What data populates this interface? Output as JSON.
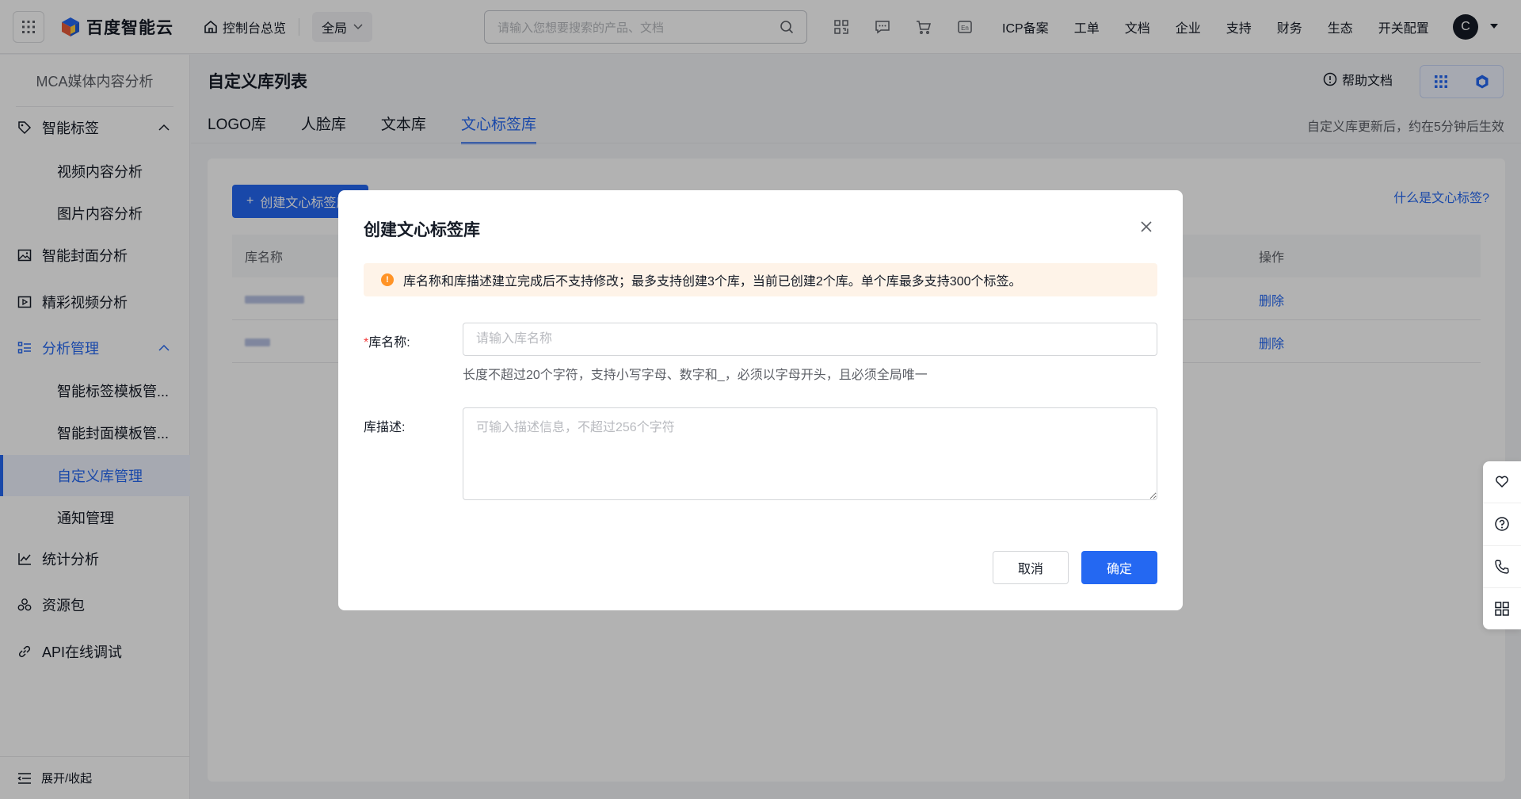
{
  "topbar": {
    "brand": "百度智能云",
    "console": "控制台总览",
    "scope": "全局",
    "search_placeholder": "请输入您想要搜索的产品、文档",
    "links": [
      "ICP备案",
      "工单",
      "文档",
      "企业",
      "支持",
      "财务",
      "生态",
      "开关配置"
    ],
    "avatar": "C"
  },
  "sidebar": {
    "title": "MCA媒体内容分析",
    "items": [
      {
        "label": "智能标签",
        "icon": "tag-icon"
      },
      {
        "label": "视频内容分析"
      },
      {
        "label": "图片内容分析"
      },
      {
        "label": "智能封面分析",
        "icon": "image-icon"
      },
      {
        "label": "精彩视频分析",
        "icon": "video-icon"
      },
      {
        "label": "分析管理",
        "icon": "list-icon"
      },
      {
        "label": "智能标签模板管..."
      },
      {
        "label": "智能封面模板管..."
      },
      {
        "label": "自定义库管理"
      },
      {
        "label": "通知管理"
      },
      {
        "label": "统计分析",
        "icon": "chart-icon"
      },
      {
        "label": "资源包",
        "icon": "package-icon"
      },
      {
        "label": "API在线调试",
        "icon": "link-icon"
      }
    ],
    "footer": "展开/收起"
  },
  "main": {
    "title": "自定义库列表",
    "help": "帮助文档",
    "tabs": [
      "LOGO库",
      "人脸库",
      "文本库",
      "文心标签库"
    ],
    "tab_note": "自定义库更新后，约在5分钟后生效",
    "create_button": "创建文心标签库",
    "what_link": "什么是文心标签?",
    "table": {
      "col_name": "库名称",
      "col_action": "操作",
      "rows": [
        {
          "action": "删除"
        },
        {
          "action": "删除"
        }
      ]
    }
  },
  "modal": {
    "title": "创建文心标签库",
    "alert": "库名称和库描述建立完成后不支持修改；最多支持创建3个库，当前已创建2个库。单个库最多支持300个标签。",
    "name_required": "*",
    "name_label": "库名称:",
    "name_placeholder": "请输入库名称",
    "name_value": "",
    "name_hint": "长度不超过20个字符，支持小写字母、数字和_，必须以字母开头，且必须全局唯一",
    "desc_label": "库描述:",
    "desc_placeholder": "可输入描述信息，不超过256个字符",
    "cancel": "取消",
    "confirm": "确定"
  },
  "colors": {
    "primary": "#2468f2",
    "warning": "#ff9326"
  }
}
